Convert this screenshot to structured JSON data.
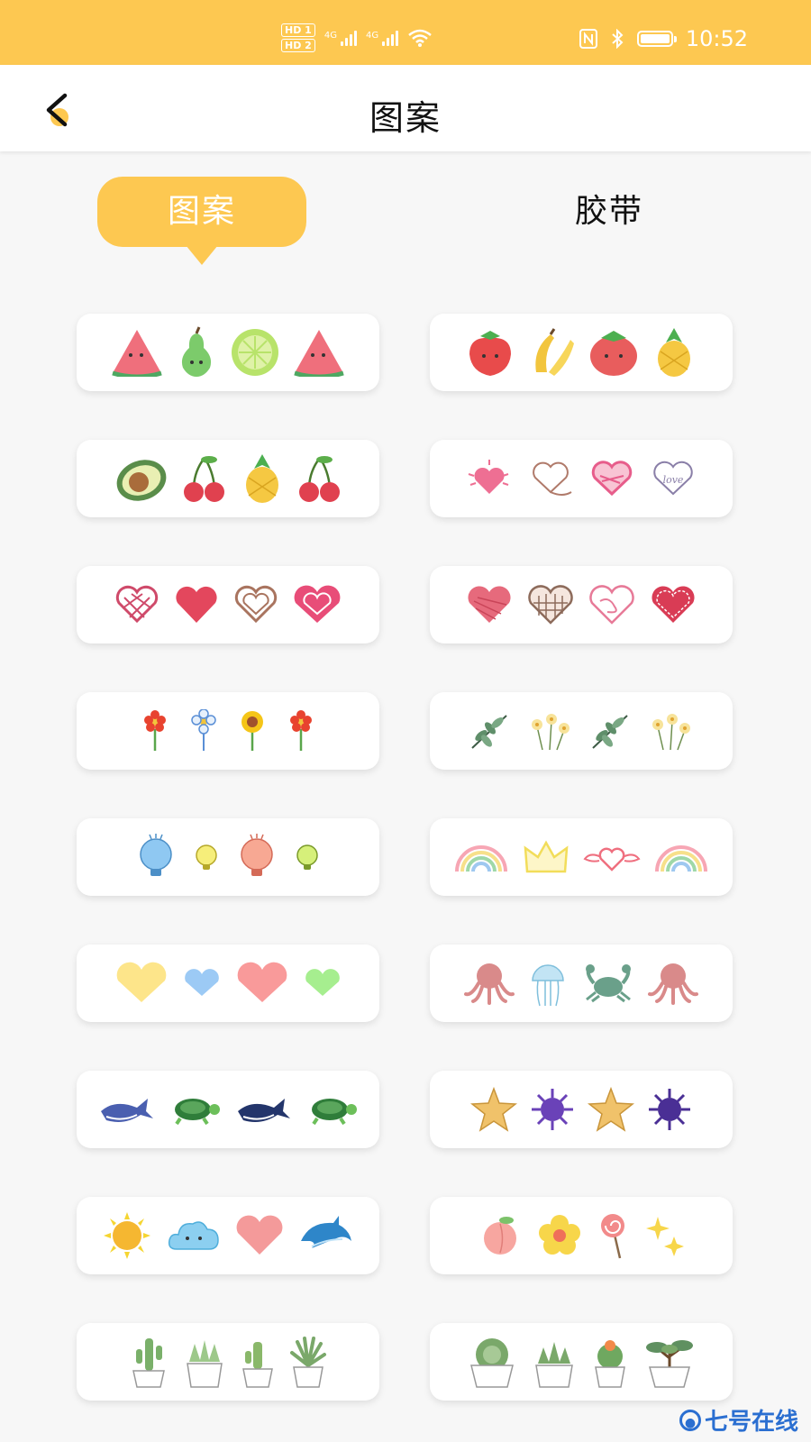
{
  "status_bar": {
    "hd1": "HD 1",
    "hd2": "HD 2",
    "net1": "4G",
    "net2": "4G",
    "time": "10:52",
    "icons": [
      "nfc-icon",
      "bluetooth-icon",
      "battery-icon",
      "wifi-icon"
    ]
  },
  "nav": {
    "title": "图案",
    "back_icon": "back-arrow-icon"
  },
  "tabs": {
    "active": "图案",
    "inactive": "胶带"
  },
  "colors": {
    "accent": "#fdc851",
    "background": "#f7f7f7",
    "card": "#ffffff"
  },
  "pattern_cards": [
    {
      "name": "fruit-watermelon-pear-lime",
      "icons": [
        "watermelon-icon",
        "pear-icon",
        "lime-icon",
        "watermelon-icon"
      ]
    },
    {
      "name": "fruit-strawberry-banana",
      "icons": [
        "strawberry-icon",
        "banana-icon",
        "tomato-icon",
        "pineapple-icon"
      ]
    },
    {
      "name": "fruit-avocado-cherry",
      "icons": [
        "avocado-icon",
        "cherry-icon",
        "pineapple-icon",
        "cherry-icon"
      ]
    },
    {
      "name": "hearts-sketch",
      "icons": [
        "sparkle-heart-icon",
        "outline-heart-icon",
        "scribble-heart-icon",
        "love-heart-icon"
      ]
    },
    {
      "name": "hearts-red",
      "icons": [
        "lattice-heart-icon",
        "red-heart-icon",
        "brown-outline-heart-icon",
        "pink-heart-icon"
      ]
    },
    {
      "name": "hearts-textured",
      "icons": [
        "crayon-heart-icon",
        "checked-heart-icon",
        "scribble-heart-icon",
        "stitched-heart-icon"
      ]
    },
    {
      "name": "flowers-small",
      "icons": [
        "red-flower-icon",
        "blue-flower-icon",
        "sunflower-icon",
        "red-flower-icon"
      ]
    },
    {
      "name": "plants-leaves",
      "icons": [
        "leaf-branch-icon",
        "yellow-flowers-icon",
        "leaf-branch-icon",
        "yellow-flowers-icon"
      ]
    },
    {
      "name": "lightbulbs",
      "icons": [
        "blue-bulb-icon",
        "yellow-bulb-icon",
        "pink-bulb-icon",
        "green-bulb-icon"
      ]
    },
    {
      "name": "rainbows",
      "icons": [
        "rainbow-icon",
        "crown-icon",
        "winged-heart-icon",
        "rainbow-icon"
      ]
    },
    {
      "name": "hearts-pastel",
      "icons": [
        "yellow-heart-icon",
        "blue-heart-icon",
        "pink-heart-icon",
        "green-heart-icon"
      ]
    },
    {
      "name": "sea-creatures",
      "icons": [
        "octopus-icon",
        "jellyfish-icon",
        "crab-icon",
        "octopus-icon"
      ]
    },
    {
      "name": "ocean-animals",
      "icons": [
        "whale-icon",
        "turtle-icon",
        "whale-icon",
        "turtle-icon"
      ]
    },
    {
      "name": "starfish-urchin",
      "icons": [
        "starfish-icon",
        "urchin-icon",
        "starfish-icon",
        "urchin-icon"
      ]
    },
    {
      "name": "weather-dolphin",
      "icons": [
        "sun-icon",
        "cloud-icon",
        "heart-icon",
        "dolphin-icon"
      ]
    },
    {
      "name": "sweets",
      "icons": [
        "peach-icon",
        "flower-icon",
        "lollipop-icon",
        "sparkle-icon"
      ]
    },
    {
      "name": "cactus-pots",
      "icons": [
        "cactus-icon",
        "succulent-icon",
        "cactus-icon",
        "aloe-icon"
      ]
    },
    {
      "name": "succulent-pots",
      "icons": [
        "succulent-icon",
        "succulent-icon",
        "cactus-flower-icon",
        "bonsai-icon"
      ]
    }
  ],
  "watermark": {
    "text": "七号在线"
  }
}
